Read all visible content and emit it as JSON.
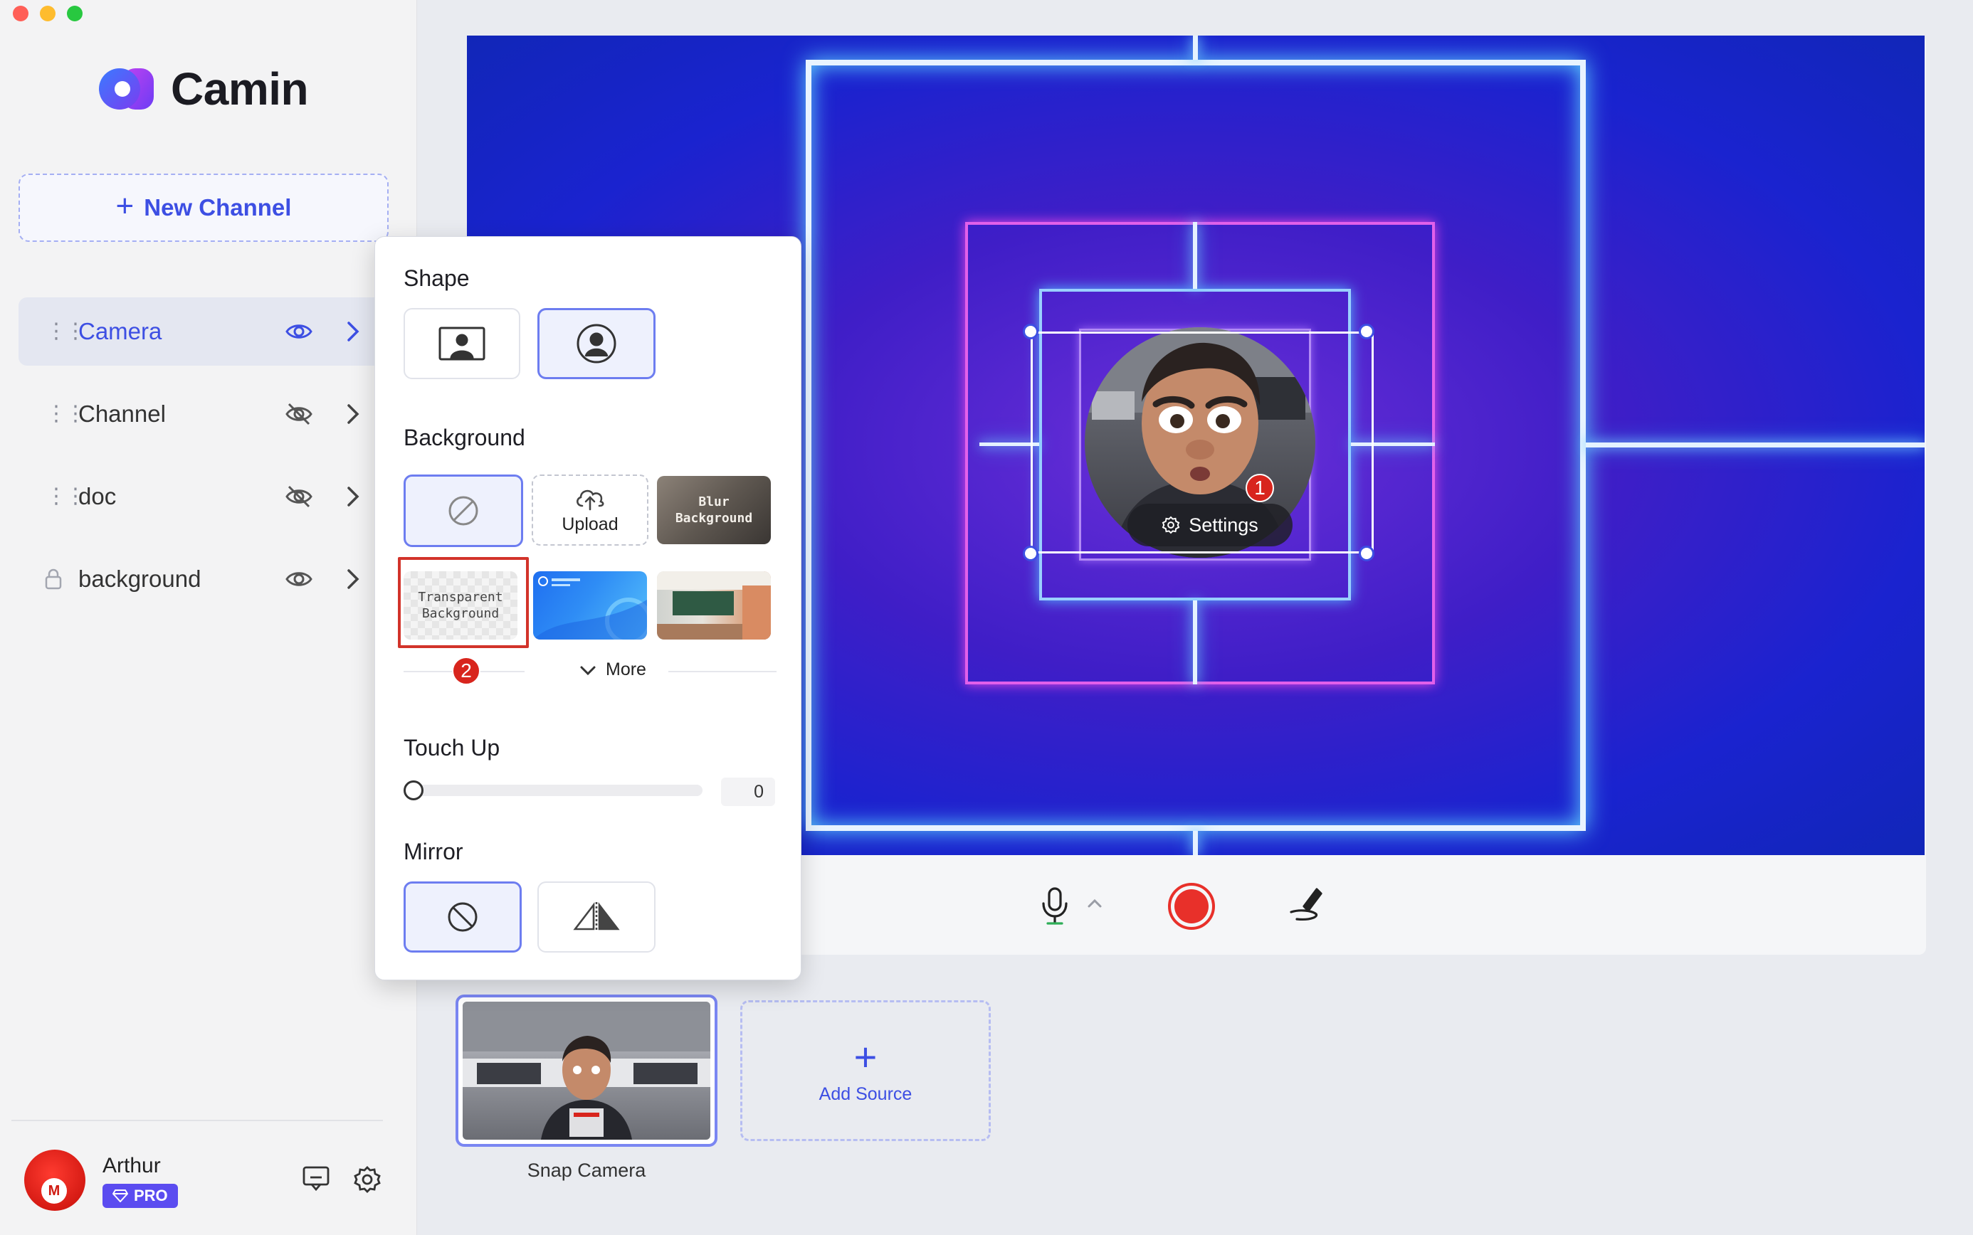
{
  "app": {
    "name": "Camin"
  },
  "sidebar": {
    "new_channel_label": "New Channel",
    "layers": [
      {
        "label": "Camera",
        "active": true,
        "visible": true,
        "locked": false
      },
      {
        "label": "Channel",
        "active": false,
        "visible": false,
        "locked": false
      },
      {
        "label": "doc",
        "active": false,
        "visible": false,
        "locked": false
      },
      {
        "label": "background",
        "active": false,
        "visible": true,
        "locked": true
      }
    ],
    "user": {
      "name": "Arthur",
      "badge": "PRO"
    }
  },
  "popup": {
    "shape_title": "Shape",
    "background_title": "Background",
    "upload_label": "Upload",
    "blur_label_line1": "Blur",
    "blur_label_line2": "Background",
    "transparent_label_line1": "Transparent",
    "transparent_label_line2": "Background",
    "more_label": "More",
    "touchup_title": "Touch Up",
    "touchup_value": "0",
    "mirror_title": "Mirror"
  },
  "preview": {
    "settings_label": "Settings",
    "step_badge_1": "1",
    "step_badge_2": "2"
  },
  "sources": {
    "items": [
      {
        "label": "Snap Camera",
        "selected": true
      }
    ],
    "add_label": "Add Source"
  },
  "colors": {
    "accent": "#3d4fe3",
    "record": "#e8302a",
    "badge_red": "#d8251d"
  }
}
